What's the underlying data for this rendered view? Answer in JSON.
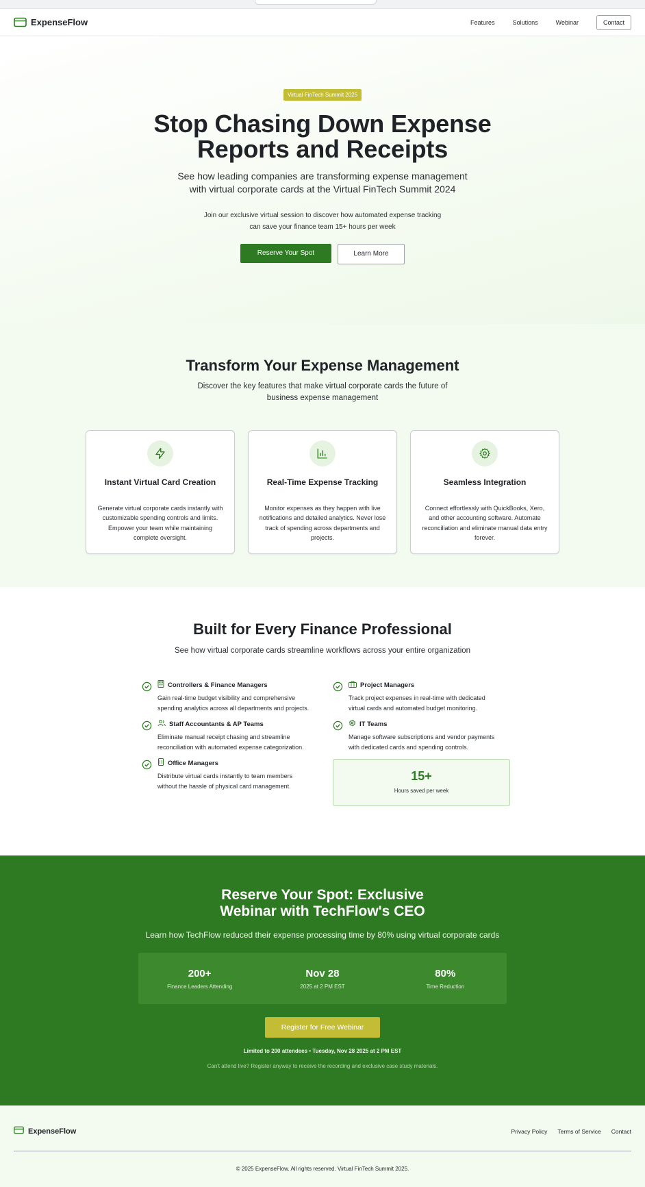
{
  "nav": {
    "brand": "ExpenseFlow",
    "links": [
      "Features",
      "Solutions",
      "Webinar"
    ],
    "contact": "Contact"
  },
  "hero": {
    "badge": "Virtual FinTech Summit 2025",
    "title_line1": "Stop Chasing Down Expense",
    "title_line2": "Reports and Receipts",
    "subtitle_line1": "See how leading companies are transforming expense management",
    "subtitle_line2": "with virtual corporate cards at the Virtual FinTech Summit 2024",
    "desc_line1": "Join our exclusive virtual session to discover how automated expense tracking",
    "desc_line2": "can save your finance team 15+ hours per week",
    "primary_cta": "Reserve Your Spot",
    "secondary_cta": "Learn More"
  },
  "features": {
    "title": "Transform Your Expense Management",
    "subtitle_line1": "Discover the key features that make virtual corporate cards the future of",
    "subtitle_line2": "business expense management",
    "cards": [
      {
        "icon": "lightning-icon",
        "title": "Instant Virtual Card Creation",
        "desc": "Generate virtual corporate cards instantly with customizable spending controls and limits. Empower your team while maintaining complete oversight."
      },
      {
        "icon": "bar-chart-icon",
        "title": "Real-Time Expense Tracking",
        "desc": "Monitor expenses as they happen with live notifications and detailed analytics. Never lose track of spending across departments and projects."
      },
      {
        "icon": "gear-icon",
        "title": "Seamless Integration",
        "desc": "Connect effortlessly with QuickBooks, Xero, and other accounting software. Automate reconciliation and eliminate manual data entry forever."
      }
    ]
  },
  "roles": {
    "title": "Built for Every Finance Professional",
    "subtitle": "See how virtual corporate cards streamline workflows across your entire organization",
    "left": [
      {
        "icon": "calculator-icon",
        "title": "Controllers & Finance Managers",
        "desc": "Gain real-time budget visibility and comprehensive spending analytics across all departments and projects."
      },
      {
        "icon": "users-icon",
        "title": "Staff Accountants & AP Teams",
        "desc": "Eliminate manual receipt chasing and streamline reconciliation with automated expense categorization."
      },
      {
        "icon": "building-icon",
        "title": "Office Managers",
        "desc": "Distribute virtual cards instantly to team members without the hassle of physical card management."
      }
    ],
    "right": [
      {
        "icon": "briefcase-icon",
        "title": "Project Managers",
        "desc": "Track project expenses in real-time with dedicated virtual cards and automated budget monitoring."
      },
      {
        "icon": "gear-icon",
        "title": "IT Teams",
        "desc": "Manage software subscriptions and vendor payments with dedicated cards and spending controls."
      }
    ],
    "stat": {
      "value": "15+",
      "label": "Hours saved per week"
    }
  },
  "webinar": {
    "title_line1": "Reserve Your Spot: Exclusive",
    "title_line2": "Webinar with TechFlow's CEO",
    "subtitle": "Learn how TechFlow reduced their expense processing time by 80% using virtual corporate cards",
    "stats": [
      {
        "value": "200+",
        "label": "Finance Leaders Attending"
      },
      {
        "value": "Nov 28",
        "label": "2025 at 2 PM EST"
      },
      {
        "value": "80%",
        "label": "Time Reduction"
      }
    ],
    "cta": "Register for Free Webinar",
    "limited": "Limited to 200 attendees • Tuesday, Nov 28 2025 at 2 PM EST",
    "note": "Can't attend live? Register anyway to receive the recording and exclusive case study materials."
  },
  "footer": {
    "brand": "ExpenseFlow",
    "links": [
      "Privacy Policy",
      "Terms of Service",
      "Contact"
    ],
    "copyright": "© 2025 ExpenseFlow. All rights reserved. Virtual FinTech Summit 2025."
  },
  "colors": {
    "primary_green": "#2e7a22",
    "accent_yellow": "#c3bd36",
    "light_green_bg": "#f3faef"
  }
}
